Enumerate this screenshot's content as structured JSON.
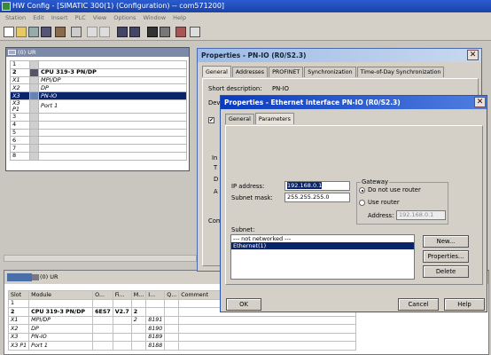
{
  "app": {
    "title": "HW Config - [SIMATIC 300(1) (Configuration) -- com571200]"
  },
  "menu": [
    "Station",
    "Edit",
    "Insert",
    "PLC",
    "View",
    "Options",
    "Window",
    "Help"
  ],
  "rack": {
    "title": "(0) UR",
    "rows": [
      {
        "slot": "1",
        "module": "",
        "style": ""
      },
      {
        "slot": "2",
        "module": "CPU 319-3 PN/DP",
        "style": "bold"
      },
      {
        "slot": "X1",
        "module": "MPI/DP",
        "style": "italic"
      },
      {
        "slot": "X2",
        "module": "DP",
        "style": "italic"
      },
      {
        "slot": "X3",
        "module": "PN-IO",
        "style": "italic",
        "selected": true
      },
      {
        "slot": "X3 P1",
        "module": "Port 1",
        "style": "italic"
      },
      {
        "slot": "3",
        "module": "",
        "style": ""
      },
      {
        "slot": "4",
        "module": "",
        "style": ""
      },
      {
        "slot": "5",
        "module": "",
        "style": ""
      },
      {
        "slot": "6",
        "module": "",
        "style": ""
      },
      {
        "slot": "7",
        "module": "",
        "style": ""
      },
      {
        "slot": "8",
        "module": "",
        "style": ""
      }
    ]
  },
  "lower": {
    "title": "(0) UR",
    "headers": [
      "Slot",
      "Module",
      "O...",
      "Fi...",
      "M...",
      "I...",
      "Q...",
      "Comment"
    ],
    "rows": [
      {
        "slot": "1",
        "module": "",
        "order": "",
        "fw": "",
        "m": "",
        "i": "",
        "q": "",
        "style": ""
      },
      {
        "slot": "2",
        "module": "CPU 319-3 PN/DP",
        "order": "6ES7",
        "fw": "V2.7",
        "m": "2",
        "i": "",
        "q": "",
        "style": "bold"
      },
      {
        "slot": "X1",
        "module": "MPI/DP",
        "order": "",
        "fw": "",
        "m": "2",
        "i": "8191",
        "q": "",
        "style": "italic"
      },
      {
        "slot": "X2",
        "module": "DP",
        "order": "",
        "fw": "",
        "m": "",
        "i": "8190",
        "q": "",
        "style": "italic"
      },
      {
        "slot": "X3",
        "module": "PN-IO",
        "order": "",
        "fw": "",
        "m": "",
        "i": "8189",
        "q": "",
        "style": "italic"
      },
      {
        "slot": "X3 P1",
        "module": "Port 1",
        "order": "",
        "fw": "",
        "m": "",
        "i": "8188",
        "q": "",
        "style": "italic"
      }
    ]
  },
  "pnio_dialog": {
    "title": "Properties - PN-IO (R0/S2.3)",
    "tabs": [
      "General",
      "Addresses",
      "PROFINET",
      "Synchronization",
      "Time-of-Day Synchronization"
    ],
    "short_desc_label": "Short description:",
    "short_desc_value": "PN-IO",
    "dev_label": "Dev",
    "in_label": "In",
    "t_label": "T",
    "d_label": "D",
    "a_label": "A",
    "com_label": "Com"
  },
  "eth_dialog": {
    "title": "Properties - Ethernet interface  PN-IO (R0/S2.3)",
    "tabs": [
      "General",
      "Parameters"
    ],
    "ip_label": "IP address:",
    "ip_value": "192.168.0.1",
    "mask_label": "Subnet mask:",
    "mask_value": "255.255.255.0",
    "gateway_label": "Gateway",
    "no_router_label": "Do not use router",
    "use_router_label": "Use router",
    "address_label": "Address:",
    "address_value": "192.168.0.1",
    "subnet_label": "Subnet:",
    "subnets": [
      "--- not networked ---",
      "Ethernet(1)"
    ],
    "new_btn": "New...",
    "props_btn": "Properties...",
    "delete_btn": "Delete",
    "ok_btn": "OK",
    "cancel_btn": "Cancel",
    "help_btn": "Help"
  },
  "colors": {
    "title_blue": "#1a43a8",
    "selection": "#0a246a",
    "dialog_bg": "#d4d0c8"
  }
}
